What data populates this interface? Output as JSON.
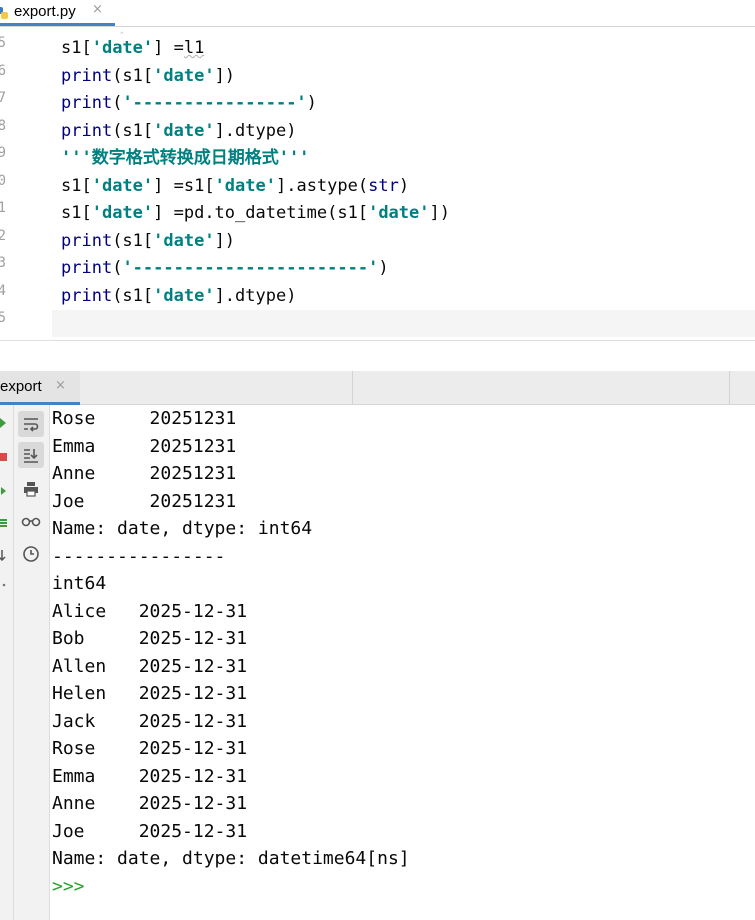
{
  "editor": {
    "tab": {
      "label": "export.py",
      "close": "×"
    },
    "gutter_numbers": [
      "5",
      "6",
      "7",
      "8",
      "9",
      "0",
      "1",
      "2",
      "3",
      "4",
      "5"
    ],
    "lines": [
      [
        {
          "t": "s1[",
          "c": ""
        },
        {
          "t": "'date'",
          "c": "strb"
        },
        {
          "t": "] =",
          "c": ""
        },
        {
          "t": "l1",
          "c": "sq"
        }
      ],
      [
        {
          "t": "print",
          "c": "kw"
        },
        {
          "t": "(s1[",
          "c": ""
        },
        {
          "t": "'date'",
          "c": "strb"
        },
        {
          "t": "])",
          "c": ""
        }
      ],
      [
        {
          "t": "print",
          "c": "kw"
        },
        {
          "t": "(",
          "c": ""
        },
        {
          "t": "'----------------'",
          "c": "strb"
        },
        {
          "t": ")",
          "c": ""
        }
      ],
      [
        {
          "t": "print",
          "c": "kw"
        },
        {
          "t": "(s1[",
          "c": ""
        },
        {
          "t": "'date'",
          "c": "strb"
        },
        {
          "t": "].dtype)",
          "c": ""
        }
      ],
      [
        {
          "t": "'''数字格式转换成日期格式'''",
          "c": "strb"
        }
      ],
      [
        {
          "t": "s1[",
          "c": ""
        },
        {
          "t": "'date'",
          "c": "strb"
        },
        {
          "t": "] =s1[",
          "c": ""
        },
        {
          "t": "'date'",
          "c": "strb"
        },
        {
          "t": "].astype(",
          "c": ""
        },
        {
          "t": "str",
          "c": "kw"
        },
        {
          "t": ")",
          "c": ""
        }
      ],
      [
        {
          "t": "s1[",
          "c": ""
        },
        {
          "t": "'date'",
          "c": "strb"
        },
        {
          "t": "] =pd.to_datetime(s1[",
          "c": ""
        },
        {
          "t": "'date'",
          "c": "strb"
        },
        {
          "t": "])",
          "c": ""
        }
      ],
      [
        {
          "t": "print",
          "c": "kw"
        },
        {
          "t": "(s1[",
          "c": ""
        },
        {
          "t": "'date'",
          "c": "strb"
        },
        {
          "t": "])",
          "c": ""
        }
      ],
      [
        {
          "t": "print",
          "c": "kw"
        },
        {
          "t": "(",
          "c": ""
        },
        {
          "t": "'-----------------------'",
          "c": "strb"
        },
        {
          "t": ")",
          "c": ""
        }
      ],
      [
        {
          "t": "print",
          "c": "kw"
        },
        {
          "t": "(s1[",
          "c": ""
        },
        {
          "t": "'date'",
          "c": "strb"
        },
        {
          "t": "].dtype)",
          "c": ""
        }
      ],
      []
    ]
  },
  "run": {
    "tab": {
      "label": "export",
      "close": "×"
    },
    "output": [
      "Rose     20251231",
      "Emma     20251231",
      "Anne     20251231",
      "Joe      20251231",
      "Name: date, dtype: int64",
      "----------------",
      "int64",
      "Alice   2025-12-31",
      "Bob     2025-12-31",
      "Allen   2025-12-31",
      "Helen   2025-12-31",
      "Jack    2025-12-31",
      "Rose    2025-12-31",
      "Emma    2025-12-31",
      "Anne    2025-12-31",
      "Joe     2025-12-31",
      "Name: date, dtype: datetime64[ns]"
    ],
    "prompt": ">>>"
  },
  "colors": {
    "keyword": "#000080",
    "string": "#008080",
    "prompt": "#29a329",
    "accent": "#4083c9"
  },
  "icons": [
    "python-file-icon",
    "soft-wrap-icon",
    "scroll-to-end-icon",
    "print-icon",
    "glasses-icon",
    "clock-icon",
    "run-icon",
    "stop-icon",
    "rerun-icon",
    "layout-icon",
    "pin-icon"
  ]
}
